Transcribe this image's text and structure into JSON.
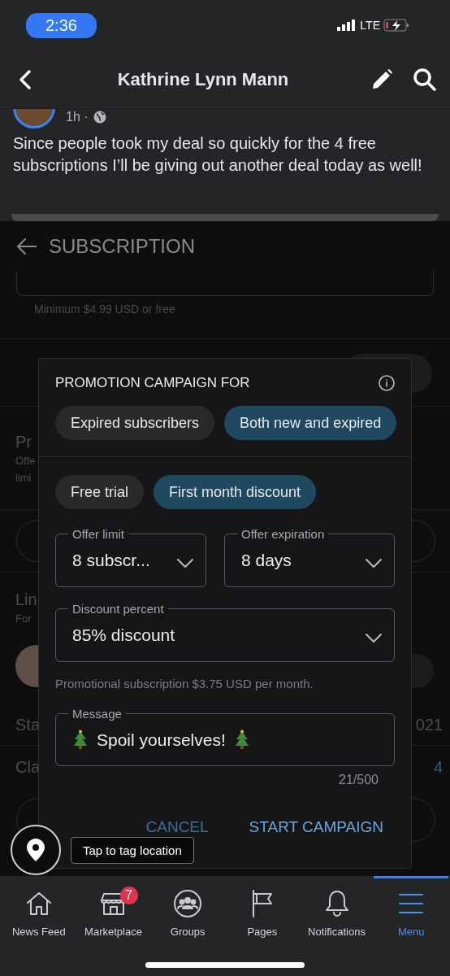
{
  "status_bar": {
    "time": "2:36",
    "network": "LTE"
  },
  "nav": {
    "title": "Kathrine Lynn Mann"
  },
  "post": {
    "meta": "1h ·",
    "text": "Since people took my deal so quickly for the 4 free subscriptions I’ll be giving out another deal today as well!"
  },
  "shared_screen": {
    "title": "SUBSCRIPTION",
    "hint": "Minimum $4.99 USD or free",
    "left_fragments": [
      "Pr",
      "Offe",
      "limi",
      "Lin",
      "For",
      "Sta",
      "Cla"
    ],
    "right_fragments": [
      "021",
      "4"
    ],
    "dialog": {
      "title": "PROMOTION CAMPAIGN FOR",
      "audience": [
        {
          "label": "Expired subscribers",
          "selected": false
        },
        {
          "label": "Both new and expired",
          "selected": true
        }
      ],
      "offer_type": [
        {
          "label": "Free trial",
          "selected": false
        },
        {
          "label": "First month discount",
          "selected": true
        }
      ],
      "fields": [
        {
          "label": "Offer limit",
          "value": "8 subscr..."
        },
        {
          "label": "Offer expiration",
          "value": "8 days"
        },
        {
          "label": "Discount percent",
          "value": "85% discount"
        }
      ],
      "note": "Promotional subscription $3.75 USD per month.",
      "message": {
        "label": "Message",
        "value": "Spoil yourselves!"
      },
      "counter": "21/500",
      "buttons": [
        "CANCEL",
        "START CAMPAIGN"
      ]
    }
  },
  "location_tip": {
    "label": "Tap to tag location"
  },
  "tab_bar": [
    {
      "kind": "home",
      "label": "News Feed",
      "selected": false
    },
    {
      "kind": "store",
      "label": "Marketplace",
      "selected": false,
      "badge": "7"
    },
    {
      "kind": "groups",
      "label": "Groups",
      "selected": false
    },
    {
      "kind": "flag",
      "label": "Pages",
      "selected": false
    },
    {
      "kind": "bell",
      "label": "Notifications",
      "selected": false
    },
    {
      "kind": "menu",
      "label": "Menu",
      "selected": true
    }
  ]
}
